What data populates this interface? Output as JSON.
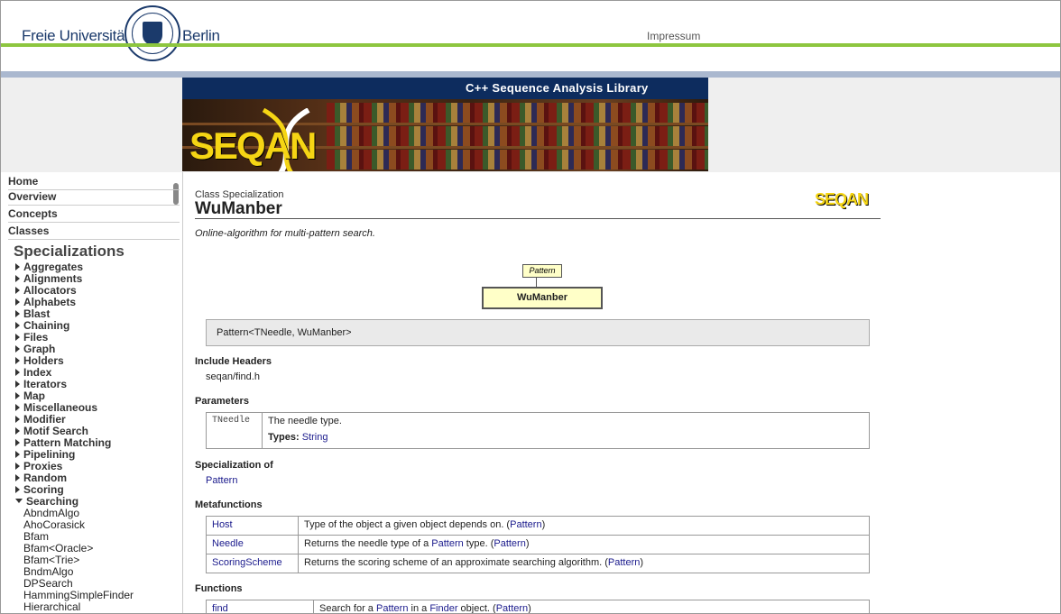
{
  "header": {
    "brand_left": "Freie Universität",
    "brand_right": "Berlin",
    "impressum": "Impressum"
  },
  "banner": {
    "title": "C++ Sequence Analysis Library",
    "logo_text": "SEQAN"
  },
  "sidebar": {
    "nav": [
      "Home",
      "Overview",
      "Concepts",
      "Classes"
    ],
    "section_title": "Specializations",
    "categories": [
      "Aggregates",
      "Alignments",
      "Allocators",
      "Alphabets",
      "Blast",
      "Chaining",
      "Files",
      "Graph",
      "Holders",
      "Index",
      "Iterators",
      "Map",
      "Miscellaneous",
      "Modifier",
      "Motif Search",
      "Pattern Matching",
      "Pipelining",
      "Proxies",
      "Random",
      "Scoring"
    ],
    "open_category": "Searching",
    "open_items": [
      "AbndmAlgo",
      "AhoCorasick",
      "Bfam",
      "Bfam<Oracle>",
      "Bfam<Trie>",
      "BndmAlgo",
      "DPSearch",
      "HammingSimpleFinder",
      "Hierarchical"
    ]
  },
  "main": {
    "kind": "Class Specialization",
    "title": "WuManber",
    "logo_text": "SEQAN",
    "description": "Online-algorithm for multi-pattern search.",
    "diagram": {
      "parent": "Pattern",
      "child": "WuManber"
    },
    "signature": "Pattern<TNeedle, WuManber>",
    "include_heading": "Include Headers",
    "include": "seqan/find.h",
    "params_heading": "Parameters",
    "param": {
      "name": "TNeedle",
      "desc": "The needle type.",
      "types_label": "Types:",
      "types_value": "String"
    },
    "spec_heading": "Specialization of",
    "spec_of": "Pattern",
    "meta_heading": "Metafunctions",
    "metafunctions": [
      {
        "name": "Host",
        "pre": "Type of the object a given object depends on. (",
        "link": "Pattern",
        "post": ")"
      },
      {
        "name": "Needle",
        "pre": "Returns the needle type of a ",
        "mid_link": "Pattern",
        "mid": " type. (",
        "link": "Pattern",
        "post": ")"
      },
      {
        "name": "ScoringScheme",
        "pre": "Returns the scoring scheme of an approximate searching algorithm. (",
        "link": "Pattern",
        "post": ")"
      }
    ],
    "func_heading": "Functions",
    "functions": [
      {
        "name": "find",
        "pre": "Search for a ",
        "l1": "Pattern",
        "mid": " in a ",
        "l2": "Finder",
        "mid2": " object. (",
        "link": "Pattern",
        "post": ")"
      }
    ]
  },
  "colors": {
    "accent_green": "#8dc63f",
    "navy": "#0d2c5e",
    "link": "#1a1a8c",
    "logo_yellow": "#f5d514"
  }
}
